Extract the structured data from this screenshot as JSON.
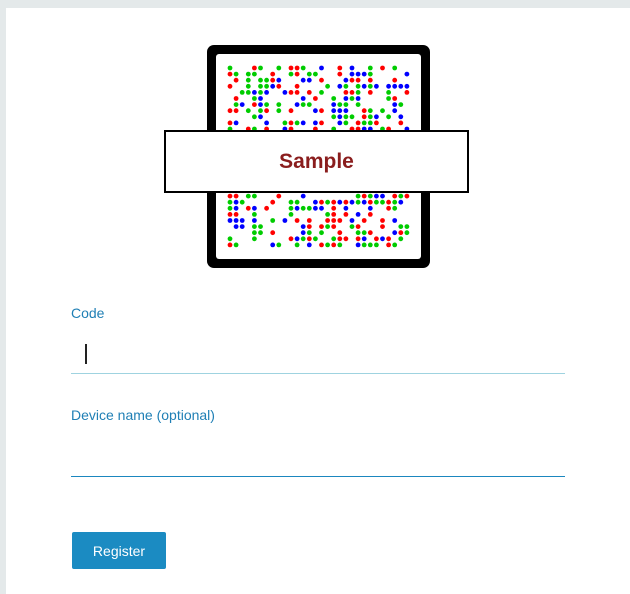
{
  "registration_code_image": {
    "overlay_text": "Sample",
    "dot_colors": [
      "#ff0000",
      "#00cc00",
      "#0000ff"
    ]
  },
  "form": {
    "code_label": "Code",
    "code_value": "",
    "device_name_label": "Device name (optional)",
    "device_name_value": ""
  },
  "actions": {
    "register_label": "Register"
  },
  "colors": {
    "label": "#1f7fb5",
    "button": "#1b8bc2",
    "overlay_text": "#8a1d1d"
  }
}
